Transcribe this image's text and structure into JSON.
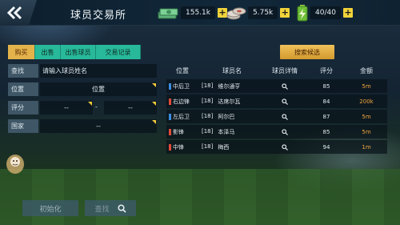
{
  "header": {
    "title": "球员交易所",
    "cash": "155.1k",
    "coins": "5.75k",
    "energy": "40/40"
  },
  "tabs": [
    "购买",
    "出售",
    "出售球员",
    "交易记录"
  ],
  "search_candidates_label": "搜索候选",
  "filters": {
    "search_label": "查找",
    "search_placeholder": "请输入球员姓名",
    "position_label": "位置",
    "position_value": "位置",
    "rating_label": "评分",
    "rating_min": "--",
    "rating_sep": "-",
    "rating_max": "--",
    "country_label": "国家",
    "country_value": "--"
  },
  "table": {
    "headers": [
      "位置",
      "球员名",
      "球员详情",
      "评分",
      "金额"
    ],
    "rows": [
      {
        "position": "中后卫",
        "level": "[18]",
        "name": "维尔通亨",
        "rating": "85",
        "amount": "5m",
        "color": "#3a8de0"
      },
      {
        "position": "右边锋",
        "level": "[18]",
        "name": "达席尔瓦",
        "rating": "84",
        "amount": "200k",
        "color": "#e04a3a"
      },
      {
        "position": "左后卫",
        "level": "[18]",
        "name": "阿尔巴",
        "rating": "87",
        "amount": "5m",
        "color": "#3a8de0"
      },
      {
        "position": "影锋",
        "level": "[18]",
        "name": "本泽马",
        "rating": "85",
        "amount": "5m",
        "color": "#e04a3a"
      },
      {
        "position": "中锋",
        "level": "[18]",
        "name": "梅西",
        "rating": "94",
        "amount": "1m",
        "color": "#e04a3a"
      }
    ]
  },
  "buttons": {
    "init": "初始化",
    "find": "查找"
  },
  "colors": {
    "accent_teal": "#27b99a",
    "accent_gold": "#e3b24a",
    "amount_orange": "#f0a640"
  },
  "icons": {
    "back": "double-chevron-left-icon",
    "cash": "cash-stack-icon",
    "coin": "coin-stack-icon",
    "energy": "battery-energy-icon",
    "search": "magnifier-icon"
  }
}
